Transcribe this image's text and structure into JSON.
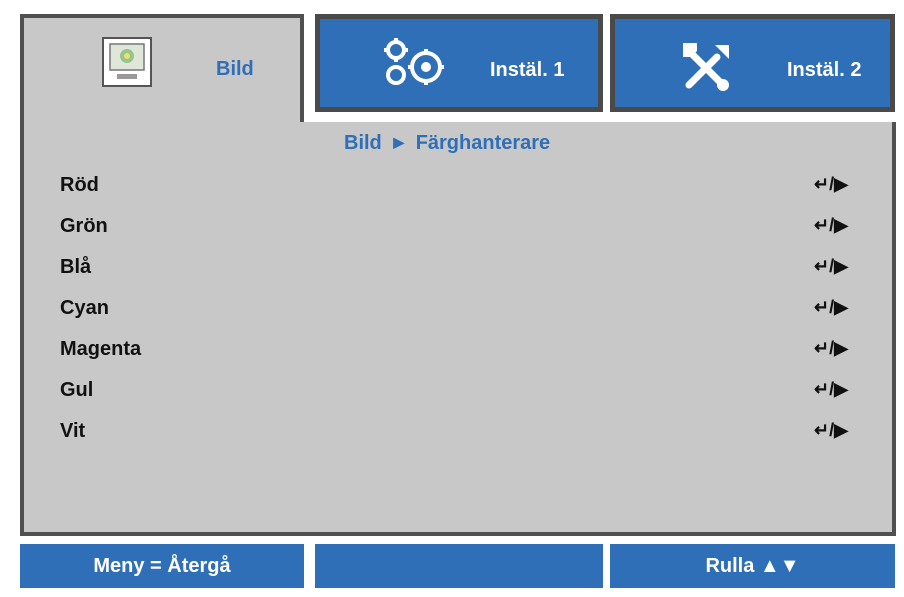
{
  "tabs": [
    {
      "label": "Bild",
      "icon": "picture-icon",
      "active": true
    },
    {
      "label": "Instäl. 1",
      "icon": "gears-icon",
      "active": false
    },
    {
      "label": "Instäl. 2",
      "icon": "tools-icon",
      "active": false
    }
  ],
  "breadcrumb": {
    "parent": "Bild",
    "separator_icon": "triangle-right-icon",
    "current": "Färghanterare"
  },
  "items": [
    {
      "label": "Röd",
      "control": "↵/▶"
    },
    {
      "label": "Grön",
      "control": "↵/▶"
    },
    {
      "label": "Blå",
      "control": "↵/▶"
    },
    {
      "label": "Cyan",
      "control": "↵/▶"
    },
    {
      "label": "Magenta",
      "control": "↵/▶"
    },
    {
      "label": "Gul",
      "control": "↵/▶"
    },
    {
      "label": "Vit",
      "control": "↵/▶"
    }
  ],
  "footer": {
    "left": "Meny = Återgå",
    "middle": "",
    "right": "Rulla ▲▼"
  },
  "colors": {
    "accent": "#2f6fb7",
    "panel": "#c8c8c8",
    "border": "#505050"
  }
}
